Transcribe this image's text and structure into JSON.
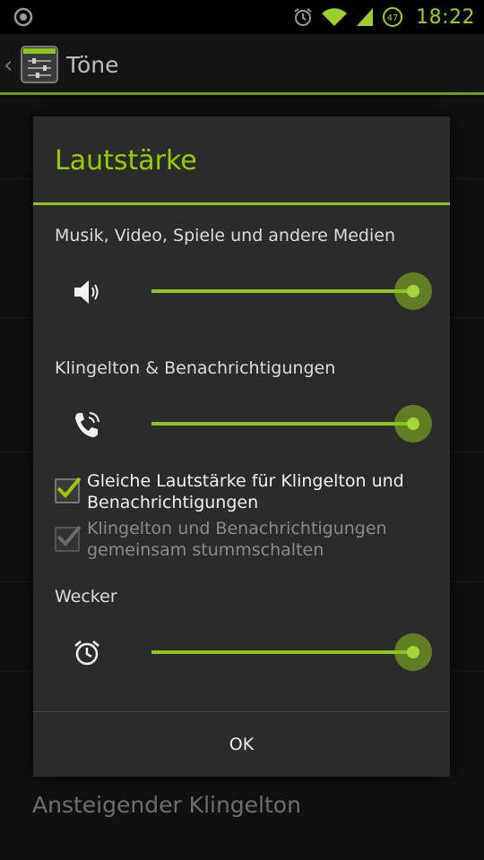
{
  "status_bar": {
    "time": "18:22",
    "battery_level": "47",
    "icons": [
      "notification-icon",
      "alarm-icon",
      "wifi-icon",
      "signal-icon",
      "battery-icon"
    ]
  },
  "action_bar": {
    "title": "Töne",
    "icon": "settings-equalizer-icon"
  },
  "background": {
    "visible_item": "Ansteigender Klingelton"
  },
  "dialog": {
    "title": "Lautstärke",
    "sections": [
      {
        "label": "Musik, Video, Spiele und andere Medien",
        "icon": "speaker-icon",
        "level": 1.0
      },
      {
        "label": "Klingelton & Benachrichtigungen",
        "icon": "phone-ring-icon",
        "level": 1.0
      },
      {
        "label": "Wecker",
        "icon": "alarm-clock-icon",
        "level": 1.0
      }
    ],
    "checkboxes": [
      {
        "label": "Gleiche Lautstärke für Klingelton und Benachrichtigungen",
        "checked": true,
        "enabled": true
      },
      {
        "label": "Klingelton und Benachrichtigungen gemeinsam stummschalten",
        "checked": true,
        "enabled": false
      }
    ],
    "ok_label": "OK"
  },
  "colors": {
    "accent": "#99cc00",
    "slider": "#8fc31f"
  }
}
